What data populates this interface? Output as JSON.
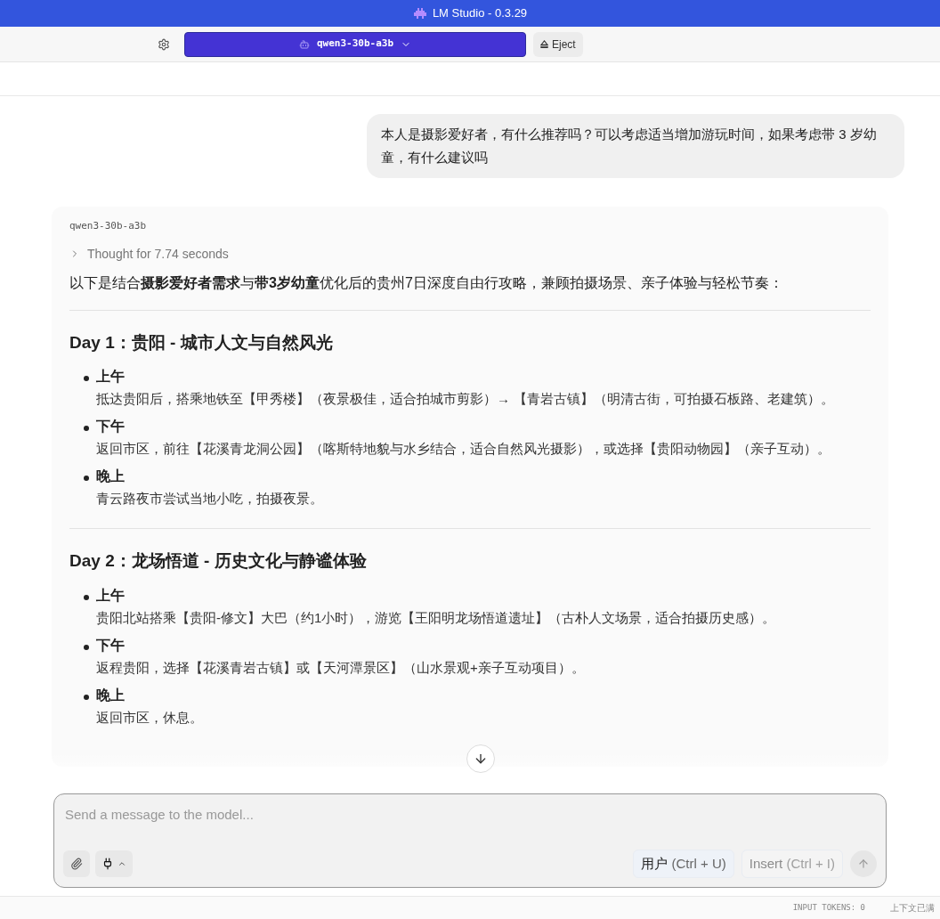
{
  "window": {
    "title": "LM Studio - 0.3.29"
  },
  "toolbar": {
    "model": "qwen3-30b-a3b",
    "eject": "Eject"
  },
  "user_message": "本人是摄影爱好者，有什么推荐吗？可以考虑适当增加游玩时间，如果考虑带 3 岁幼童，有什么建议吗",
  "assistant": {
    "model": "qwen3-30b-a3b",
    "thought": {
      "label": "Thought for 7.74 seconds",
      "expanded": false
    },
    "intro": "以下是结合**摄影爱好者需求**与**带3岁幼童**优化后的贵州7日深度自由行攻略，兼顾拍摄场景、亲子体验与轻松节奏：",
    "days": [
      {
        "title": "Day 1：贵阳 - 城市人文与自然风光",
        "items": [
          {
            "label": "上午",
            "text": "抵达贵阳后，搭乘地铁至【甲秀楼】（夜景极佳，适合拍城市剪影）→ 【青岩古镇】（明清古街，可拍摄石板路、老建筑）。"
          },
          {
            "label": "下午",
            "text": "返回市区，前往【花溪青龙洞公园】（喀斯特地貌与水乡结合，适合自然风光摄影），或选择【贵阳动物园】（亲子互动）。"
          },
          {
            "label": "晚上",
            "text": "青云路夜市尝试当地小吃，拍摄夜景。"
          }
        ]
      },
      {
        "title": "Day 2：龙场悟道 - 历史文化与静谧体验",
        "items": [
          {
            "label": "上午",
            "text": "贵阳北站搭乘【贵阳-修文】大巴（约1小时），游览【王阳明龙场悟道遗址】（古朴人文场景，适合拍摄历史感）。"
          },
          {
            "label": "下午",
            "text": "返程贵阳，选择【花溪青岩古镇】或【天河潭景区】（山水景观+亲子互动项目）。"
          },
          {
            "label": "晚上",
            "text": "返回市区，休息。"
          }
        ]
      }
    ]
  },
  "composer": {
    "placeholder": "Send a message to the model...",
    "role_button": {
      "label": "用户",
      "shortcut": "(Ctrl + U)",
      "disabled": false
    },
    "insert_button": {
      "label": "Insert",
      "shortcut": "(Ctrl + I)",
      "disabled": true
    }
  },
  "status_bar": {
    "tokens_label": "INPUT TOKENS:",
    "tokens": "0",
    "context": "上下文已满"
  }
}
